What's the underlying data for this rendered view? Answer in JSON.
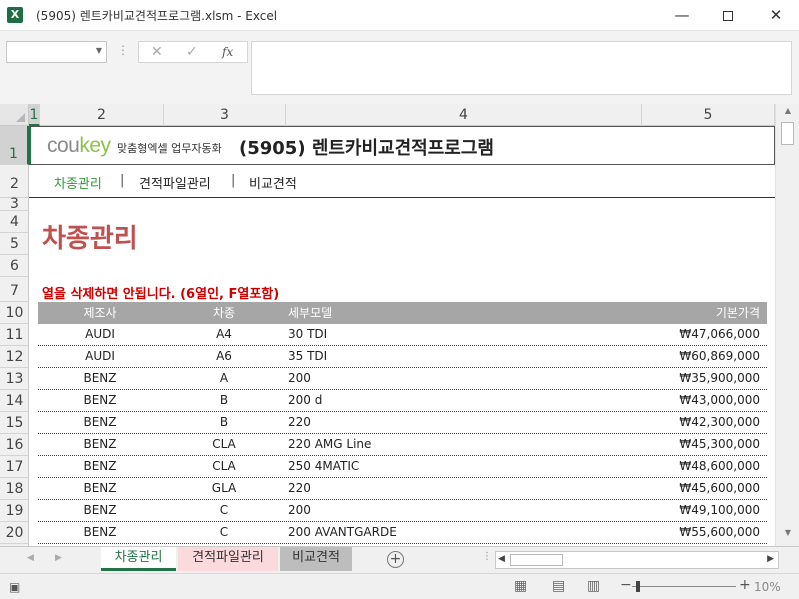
{
  "window": {
    "app_icon": "excel-icon",
    "app_icon_glyph": "X",
    "title": "(5905) 렌트카비교견적프로그램.xlsm  -  Excel",
    "minimize": "—",
    "close": "✕"
  },
  "formula_bar": {
    "name_box": "",
    "cancel_glyph": "✕",
    "enter_glyph": "✓",
    "fx_label": "fx",
    "formula": ""
  },
  "columns": [
    "1",
    "2",
    "3",
    "4",
    "5"
  ],
  "rows": [
    "1",
    "2",
    "3",
    "4",
    "5",
    "6",
    "7",
    "10",
    "11",
    "12",
    "13",
    "14",
    "15",
    "16",
    "17",
    "18",
    "19",
    "20"
  ],
  "header": {
    "logo_prefix": "cou",
    "logo_suffix": "key",
    "tagline": "맞춤형엑셀 업무자동화",
    "title": "(5905) 렌트카비교견적프로그램"
  },
  "menu": {
    "items": [
      "차종관리",
      "견적파일관리",
      "비교견적"
    ],
    "separator": "|",
    "active": 0
  },
  "section_title": "차종관리",
  "warning": "열을 삭제하면 안됩니다. (6열인, F열포함)",
  "table": {
    "headers": {
      "manufacturer": "제조사",
      "type": "차종",
      "model": "세부모델",
      "price": "기본가격"
    },
    "rows": [
      {
        "manufacturer": "AUDI",
        "type": "A4",
        "model": "30 TDI",
        "price": "₩47,066,000"
      },
      {
        "manufacturer": "AUDI",
        "type": "A6",
        "model": "35 TDI",
        "price": "₩60,869,000"
      },
      {
        "manufacturer": "BENZ",
        "type": "A",
        "model": "200",
        "price": "₩35,900,000"
      },
      {
        "manufacturer": "BENZ",
        "type": "B",
        "model": "200 d",
        "price": "₩43,000,000"
      },
      {
        "manufacturer": "BENZ",
        "type": "B",
        "model": "220",
        "price": "₩42,300,000"
      },
      {
        "manufacturer": "BENZ",
        "type": "CLA",
        "model": "220 AMG Line",
        "price": "₩45,300,000"
      },
      {
        "manufacturer": "BENZ",
        "type": "CLA",
        "model": "250 4MATIC",
        "price": "₩48,600,000"
      },
      {
        "manufacturer": "BENZ",
        "type": "GLA",
        "model": "220",
        "price": "₩45,600,000"
      },
      {
        "manufacturer": "BENZ",
        "type": "C",
        "model": "200",
        "price": "₩49,100,000"
      },
      {
        "manufacturer": "BENZ",
        "type": "C",
        "model": "200 AVANTGARDE",
        "price": "₩55,600,000"
      }
    ]
  },
  "sheet_tabs": [
    "차종관리",
    "견적파일관리",
    "비교견적"
  ],
  "add_sheet": "+",
  "status": {
    "zoom": "10%",
    "zoom_minus": "−",
    "zoom_plus": "+"
  },
  "colors": {
    "accent": "#217346",
    "section_title": "#c0504d",
    "warning": "#d00000",
    "menu_active": "#2e9a3c",
    "table_header": "#a6a6a6",
    "tab_2_bg": "#fadadd",
    "tab_3_bg": "#bdbdbd"
  }
}
